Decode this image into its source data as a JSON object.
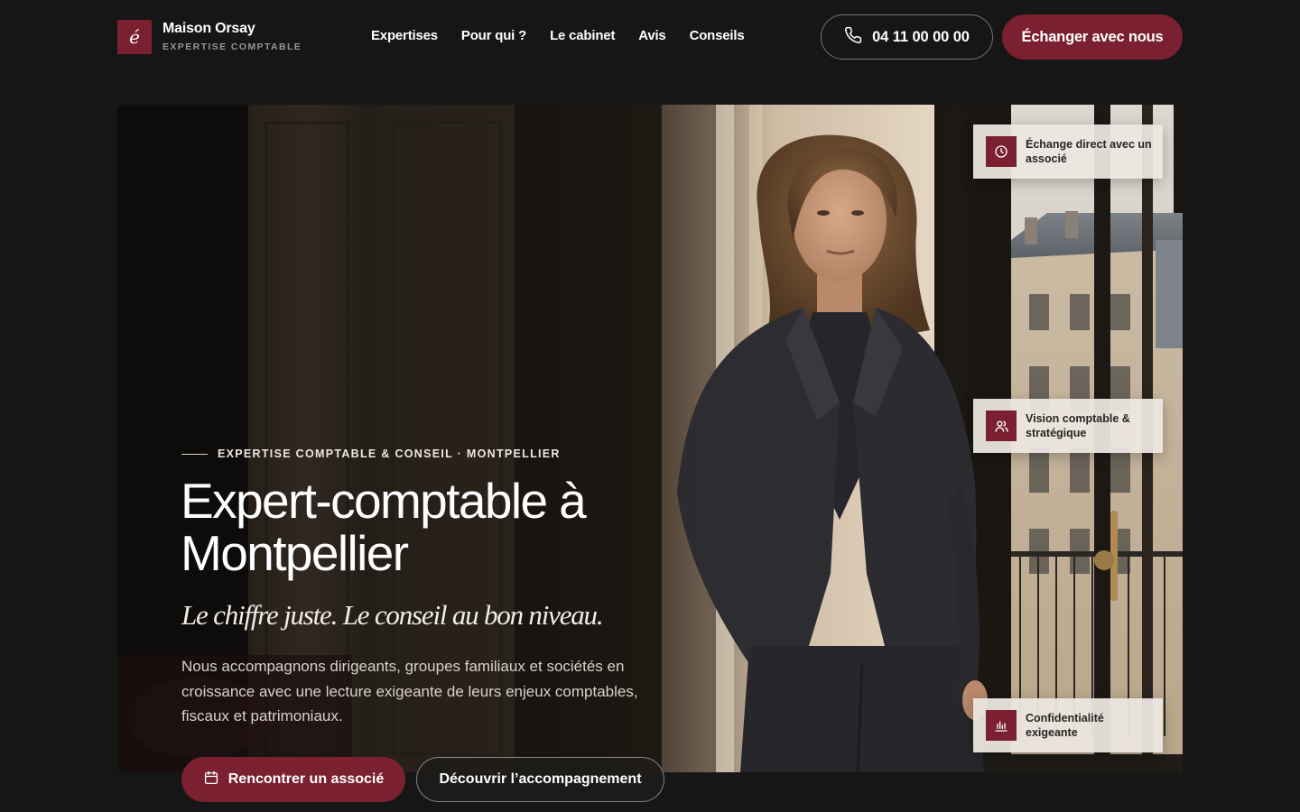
{
  "brand": {
    "mark": "é",
    "name": "Maison Orsay",
    "subtitle": "EXPERTISE COMPTABLE",
    "accent_color": "#7a2030"
  },
  "nav": {
    "items": [
      {
        "label": "Expertises"
      },
      {
        "label": "Pour qui ?"
      },
      {
        "label": "Le cabinet"
      },
      {
        "label": "Avis"
      },
      {
        "label": "Conseils"
      }
    ]
  },
  "header": {
    "phone": {
      "icon": "phone-icon",
      "label": "04 11 00 00 00"
    },
    "cta_label": "Échanger avec nous"
  },
  "hero": {
    "eyebrow": "EXPERTISE COMPTABLE & CONSEIL · MONTPELLIER",
    "title": "Expert-comptable à Montpellier",
    "tagline": "Le chiffre juste. Le conseil au bon niveau.",
    "description": "Nous accompagnons dirigeants, groupes familiaux et sociétés en croissance avec une lecture exigeante de leurs enjeux comptables, fiscaux et patrimoniaux.",
    "primary_button": {
      "icon": "calendar-icon",
      "label": "Rencontrer un associé"
    },
    "secondary_button": {
      "label": "Découvrir l’accompagnement"
    },
    "features": [
      {
        "icon": "clock-icon",
        "label": "Échange direct avec un associé"
      },
      {
        "icon": "users-icon",
        "label": "Vision comptable & stratégique"
      },
      {
        "icon": "bar-chart-icon",
        "label": "Confidentialité exigeante"
      }
    ]
  }
}
